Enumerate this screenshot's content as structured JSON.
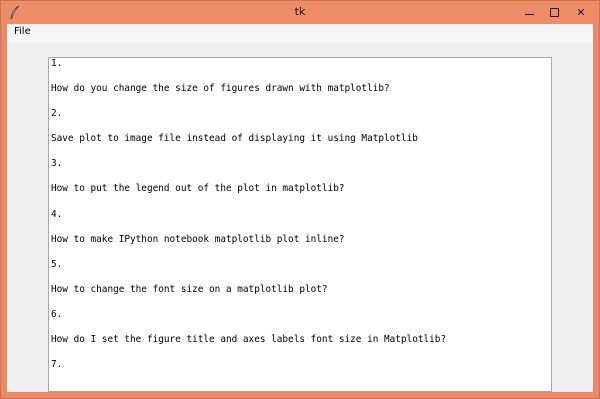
{
  "window": {
    "title": "tk",
    "controls": {
      "minimize_icon": "minimize-icon",
      "maximize_icon": "maximize-icon",
      "close_label": "✕"
    },
    "titlebar_color": "#ec8d68"
  },
  "menubar": {
    "file_label": "File"
  },
  "textbox": {
    "lines": [
      "1.",
      "How do you change the size of figures drawn with matplotlib?",
      "2.",
      "Save plot to image file instead of displaying it using Matplotlib",
      "3.",
      "How to put the legend out of the plot in matplotlib?",
      "4.",
      "How to make IPython notebook matplotlib plot inline?",
      "5.",
      "How to change the font size on a matplotlib plot?",
      "6.",
      "How do I set the figure title and axes labels font size in Matplotlib?",
      "7."
    ]
  }
}
